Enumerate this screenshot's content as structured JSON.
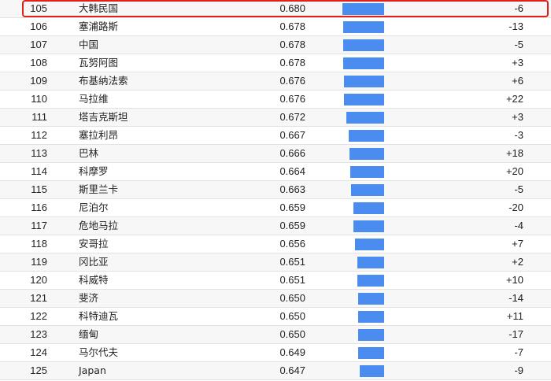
{
  "colors": {
    "bar": "#4b8cf0",
    "highlight": "#e01f1f",
    "row_alt": "#f7f7f7",
    "row_border": "#e2e2e2"
  },
  "bar_scale": {
    "min": 0.6,
    "max": 0.69
  },
  "rows": [
    {
      "rank": "105",
      "country": "大韩民国",
      "score": "0.680",
      "value": 0.68,
      "change": "-6",
      "highlighted": true
    },
    {
      "rank": "106",
      "country": "塞浦路斯",
      "score": "0.678",
      "value": 0.678,
      "change": "-13"
    },
    {
      "rank": "107",
      "country": "中国",
      "score": "0.678",
      "value": 0.678,
      "change": "-5"
    },
    {
      "rank": "108",
      "country": "瓦努阿图",
      "score": "0.678",
      "value": 0.678,
      "change": "+3"
    },
    {
      "rank": "109",
      "country": "布基纳法索",
      "score": "0.676",
      "value": 0.676,
      "change": "+6"
    },
    {
      "rank": "110",
      "country": "马拉维",
      "score": "0.676",
      "value": 0.676,
      "change": "+22"
    },
    {
      "rank": "111",
      "country": "塔吉克斯坦",
      "score": "0.672",
      "value": 0.672,
      "change": "+3"
    },
    {
      "rank": "112",
      "country": "塞拉利昂",
      "score": "0.667",
      "value": 0.667,
      "change": "-3"
    },
    {
      "rank": "113",
      "country": "巴林",
      "score": "0.666",
      "value": 0.666,
      "change": "+18"
    },
    {
      "rank": "114",
      "country": "科摩罗",
      "score": "0.664",
      "value": 0.664,
      "change": "+20"
    },
    {
      "rank": "115",
      "country": "斯里兰卡",
      "score": "0.663",
      "value": 0.663,
      "change": "-5"
    },
    {
      "rank": "116",
      "country": "尼泊尔",
      "score": "0.659",
      "value": 0.659,
      "change": "-20"
    },
    {
      "rank": "117",
      "country": "危地马拉",
      "score": "0.659",
      "value": 0.659,
      "change": "-4"
    },
    {
      "rank": "118",
      "country": "安哥拉",
      "score": "0.656",
      "value": 0.656,
      "change": "+7"
    },
    {
      "rank": "119",
      "country": "冈比亚",
      "score": "0.651",
      "value": 0.651,
      "change": "+2"
    },
    {
      "rank": "120",
      "country": "科威特",
      "score": "0.651",
      "value": 0.651,
      "change": "+10"
    },
    {
      "rank": "121",
      "country": "斐济",
      "score": "0.650",
      "value": 0.65,
      "change": "-14"
    },
    {
      "rank": "122",
      "country": "科特迪瓦",
      "score": "0.650",
      "value": 0.65,
      "change": "+11"
    },
    {
      "rank": "123",
      "country": "缅甸",
      "score": "0.650",
      "value": 0.65,
      "change": "-17"
    },
    {
      "rank": "124",
      "country": "马尔代夫",
      "score": "0.649",
      "value": 0.649,
      "change": "-7"
    },
    {
      "rank": "125",
      "country": "Japan",
      "score": "0.647",
      "value": 0.647,
      "change": "-9"
    }
  ]
}
